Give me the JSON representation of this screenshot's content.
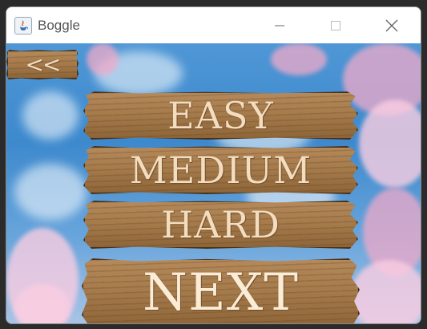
{
  "window": {
    "title": "Boggle",
    "controls": {
      "minimize": "—",
      "maximize": "☐",
      "close": "✕"
    }
  },
  "menu": {
    "back_label": "<<",
    "easy_label": "EASY",
    "medium_label": "MEDIUM",
    "hard_label": "HARD",
    "next_label": "NEXT"
  },
  "colors": {
    "sky": "#3d89cd",
    "blossom": "#f0aac8",
    "wood": "#a47a4b",
    "wood_text": "#f3ddbf"
  }
}
